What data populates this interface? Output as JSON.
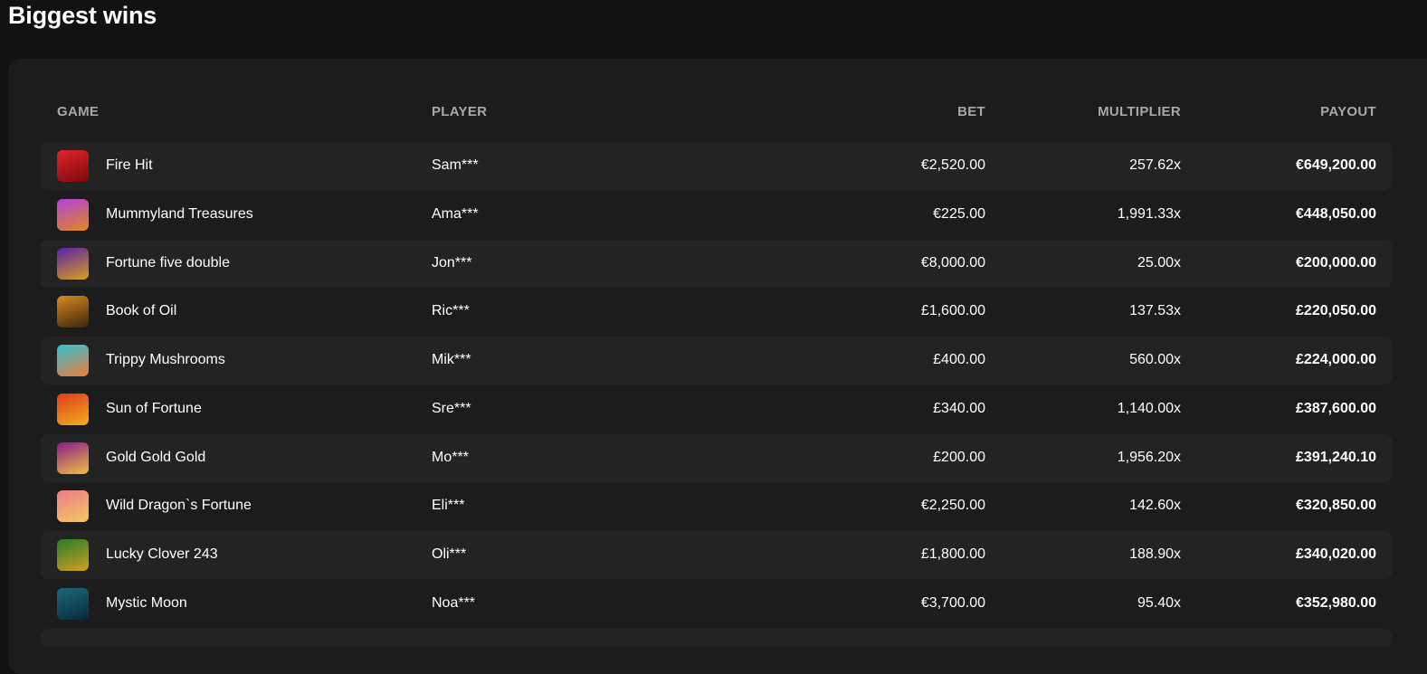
{
  "page": {
    "title": "Biggest wins"
  },
  "table": {
    "headers": {
      "game": "GAME",
      "player": "PLAYER",
      "bet": "BET",
      "multiplier": "MULTIPLIER",
      "payout": "PAYOUT"
    },
    "rows": [
      {
        "game": "Fire Hit",
        "player": "Sam***",
        "bet": "€2,520.00",
        "multiplier": "257.62x",
        "payout": "€649,200.00",
        "icon": "fire-hit-thumbnail",
        "colors": [
          "#e0242a",
          "#7a0a0c"
        ]
      },
      {
        "game": "Mummyland Treasures",
        "player": "Ama***",
        "bet": "€225.00",
        "multiplier": "1,991.33x",
        "payout": "€448,050.00",
        "icon": "mummyland-treasures-thumbnail",
        "colors": [
          "#b340e0",
          "#e08a1a"
        ]
      },
      {
        "game": "Fortune five double",
        "player": "Jon***",
        "bet": "€8,000.00",
        "multiplier": "25.00x",
        "payout": "€200,000.00",
        "icon": "fortune-five-double-thumbnail",
        "colors": [
          "#5b1fb0",
          "#d4a017"
        ]
      },
      {
        "game": "Book of Oil",
        "player": "Ric***",
        "bet": "£1,600.00",
        "multiplier": "137.53x",
        "payout": "£220,050.00",
        "icon": "book-of-oil-thumbnail",
        "colors": [
          "#d88a1c",
          "#3a2410"
        ]
      },
      {
        "game": "Trippy Mushrooms",
        "player": "Mik***",
        "bet": "£400.00",
        "multiplier": "560.00x",
        "payout": "£224,000.00",
        "icon": "trippy-mushrooms-thumbnail",
        "colors": [
          "#2ec4d8",
          "#f07a3a"
        ]
      },
      {
        "game": "Sun of Fortune",
        "player": "Sre***",
        "bet": "£340.00",
        "multiplier": "1,140.00x",
        "payout": "£387,600.00",
        "icon": "sun-of-fortune-thumbnail",
        "colors": [
          "#e03a1a",
          "#f0b020"
        ]
      },
      {
        "game": "Gold Gold Gold",
        "player": "Mo***",
        "bet": "£200.00",
        "multiplier": "1,956.20x",
        "payout": "£391,240.10",
        "icon": "gold-gold-gold-thumbnail",
        "colors": [
          "#8a1a8a",
          "#f0c040"
        ]
      },
      {
        "game": "Wild Dragon`s Fortune",
        "player": "Eli***",
        "bet": "€2,250.00",
        "multiplier": "142.60x",
        "payout": "€320,850.00",
        "icon": "wild-dragons-fortune-thumbnail",
        "colors": [
          "#f07a8a",
          "#f0c860"
        ]
      },
      {
        "game": "Lucky Clover 243",
        "player": "Oli***",
        "bet": "£1,800.00",
        "multiplier": "188.90x",
        "payout": "£340,020.00",
        "icon": "lucky-clover-243-thumbnail",
        "colors": [
          "#2a7a2a",
          "#d0a020"
        ]
      },
      {
        "game": "Mystic Moon",
        "player": "Noa***",
        "bet": "€3,700.00",
        "multiplier": "95.40x",
        "payout": "€352,980.00",
        "icon": "mystic-moon-thumbnail",
        "colors": [
          "#1a6a7a",
          "#0a2a3a"
        ]
      }
    ]
  }
}
